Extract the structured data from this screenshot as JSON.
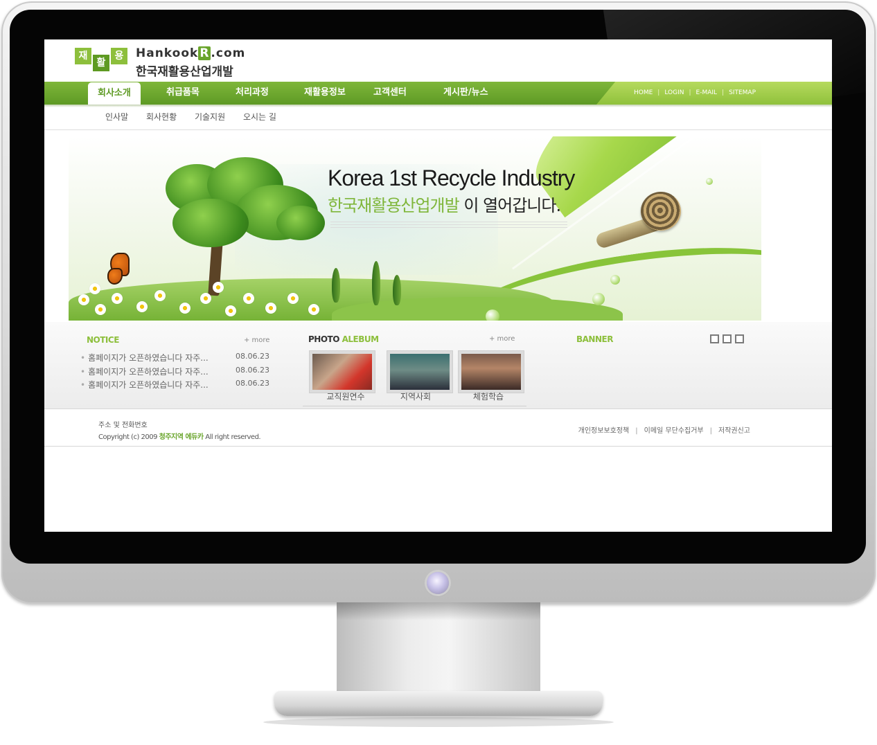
{
  "logo": {
    "box_chars": [
      "재",
      "활",
      "용"
    ],
    "en_prefix": "Hankook",
    "en_r": "R",
    "en_suffix": ".com",
    "kr": "한국재활용산업개발"
  },
  "nav": {
    "items": [
      "회사소개",
      "취급품목",
      "처리과정",
      "재활용정보",
      "고객센터",
      "게시판/뉴스"
    ],
    "active": "회사소개",
    "utility": [
      "HOME",
      "LOGIN",
      "E-MAIL",
      "SITEMAP"
    ]
  },
  "subnav": [
    "인사말",
    "회사현황",
    "기술지원",
    "오시는 길"
  ],
  "hero": {
    "title": "Korea 1st Recycle Industry",
    "subtitle_green": "한국재활용산업개발",
    "subtitle_rest": " 이 열어갑니다."
  },
  "notice": {
    "title": "NOTICE",
    "more": "+ more",
    "rows": [
      {
        "text": "홈페이지가 오픈하였습니다 자주...",
        "date": "08.06.23"
      },
      {
        "text": "홈페이지가 오픈하였습니다 자주...",
        "date": "08.06.23"
      },
      {
        "text": "홈페이지가 오픈하였습니다 자주...",
        "date": "08.06.23"
      }
    ]
  },
  "photo_album": {
    "title_dark": "PHOTO",
    "title_green": "ALEBUM",
    "more": "+ more",
    "captions": [
      "교직원연수",
      "지역사회",
      "체험학습"
    ]
  },
  "banner": {
    "title": "BANNER"
  },
  "footer": {
    "address": "주소 및 전화번호",
    "copyright_prefix": "Copyright (c)  2009 ",
    "copyright_highlight": "청주지역 에듀카",
    "copyright_suffix": " All right reserved.",
    "links": [
      "개인정보보호정책",
      "이메일 무단수집거부",
      "저작권신고"
    ]
  },
  "colors": {
    "brand_green": "#7fb63a",
    "brand_green_dark": "#5e9a24",
    "monitor_bezel": "#050505",
    "monitor_frame": "#d9d9d9"
  }
}
